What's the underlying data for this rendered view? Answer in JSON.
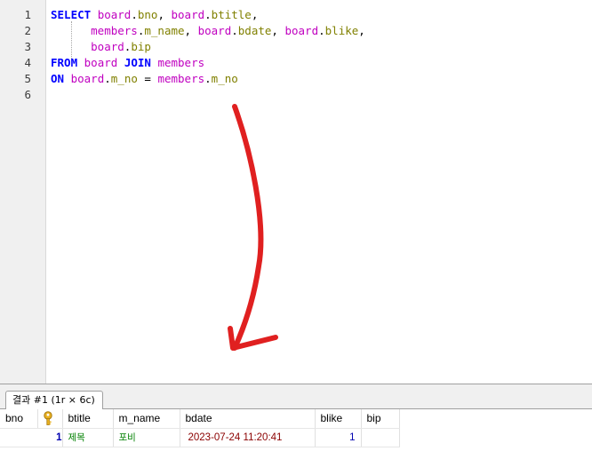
{
  "editor": {
    "line_numbers": [
      "1",
      "2",
      "3",
      "4",
      "5",
      "6"
    ],
    "lines": [
      [
        {
          "t": "SELECT",
          "c": "kw"
        },
        {
          "t": " ",
          "c": "pun"
        },
        {
          "t": "board",
          "c": "tbl"
        },
        {
          "t": ".",
          "c": "pun"
        },
        {
          "t": "bno",
          "c": "col"
        },
        {
          "t": ", ",
          "c": "pun"
        },
        {
          "t": "board",
          "c": "tbl"
        },
        {
          "t": ".",
          "c": "pun"
        },
        {
          "t": "btitle",
          "c": "col"
        },
        {
          "t": ",",
          "c": "pun"
        }
      ],
      [
        {
          "t": "      ",
          "c": "pun"
        },
        {
          "t": "members",
          "c": "tbl"
        },
        {
          "t": ".",
          "c": "pun"
        },
        {
          "t": "m_name",
          "c": "col"
        },
        {
          "t": ", ",
          "c": "pun"
        },
        {
          "t": "board",
          "c": "tbl"
        },
        {
          "t": ".",
          "c": "pun"
        },
        {
          "t": "bdate",
          "c": "col"
        },
        {
          "t": ", ",
          "c": "pun"
        },
        {
          "t": "board",
          "c": "tbl"
        },
        {
          "t": ".",
          "c": "pun"
        },
        {
          "t": "blike",
          "c": "col"
        },
        {
          "t": ",",
          "c": "pun"
        }
      ],
      [
        {
          "t": "      ",
          "c": "pun"
        },
        {
          "t": "board",
          "c": "tbl"
        },
        {
          "t": ".",
          "c": "pun"
        },
        {
          "t": "bip",
          "c": "col"
        }
      ],
      [
        {
          "t": "FROM",
          "c": "kw"
        },
        {
          "t": " ",
          "c": "pun"
        },
        {
          "t": "board",
          "c": "tbl"
        },
        {
          "t": " ",
          "c": "pun"
        },
        {
          "t": "JOIN",
          "c": "kw"
        },
        {
          "t": " ",
          "c": "pun"
        },
        {
          "t": "members",
          "c": "tbl"
        }
      ],
      [
        {
          "t": "ON",
          "c": "kw"
        },
        {
          "t": " ",
          "c": "pun"
        },
        {
          "t": "board",
          "c": "tbl"
        },
        {
          "t": ".",
          "c": "pun"
        },
        {
          "t": "m_no",
          "c": "col"
        },
        {
          "t": " = ",
          "c": "pun"
        },
        {
          "t": "members",
          "c": "tbl"
        },
        {
          "t": ".",
          "c": "pun"
        },
        {
          "t": "m_no",
          "c": "col"
        }
      ],
      []
    ],
    "annotation": {
      "icon": "red-arrow-down-icon",
      "color": "#e02020"
    }
  },
  "results": {
    "tab_label": "결과 #1 (1r × 6c)",
    "columns": [
      "bno",
      "",
      "btitle",
      "m_name",
      "bdate",
      "blike",
      "bip"
    ],
    "key_icon": "primary-key-icon",
    "rows": [
      [
        "1",
        "",
        "제목",
        "포비",
        "2023-07-24 11:20:41",
        "1",
        ""
      ]
    ],
    "colors": {
      "number": "#0000b0",
      "text": "#008000",
      "date": "#8b0000",
      "key": "#d4a017"
    }
  }
}
